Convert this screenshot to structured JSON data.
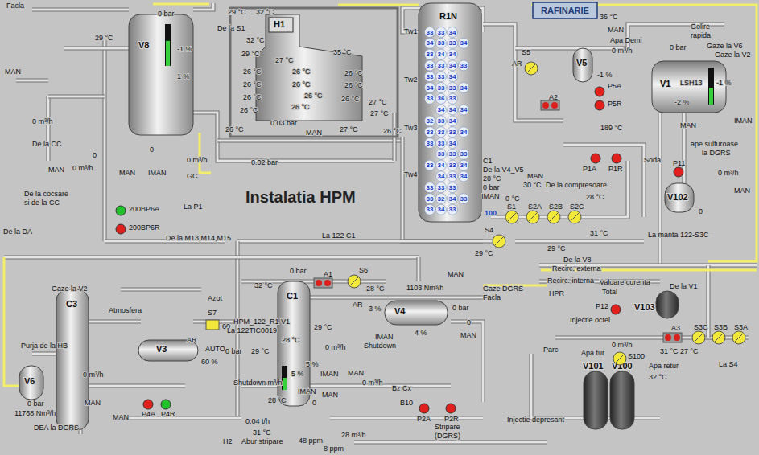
{
  "title": "Instalatia HPM",
  "badge": "RAFINARIE",
  "vessels": [
    {
      "name": "V8",
      "level": 0.6
    },
    {
      "name": "H1"
    },
    {
      "name": "R1N"
    },
    {
      "name": "V5"
    },
    {
      "name": "V1",
      "level": 0.45
    },
    {
      "name": "V102"
    },
    {
      "name": "C3"
    },
    {
      "name": "V3"
    },
    {
      "name": "V6"
    },
    {
      "name": "C1",
      "level": 0.5
    },
    {
      "name": "V4"
    },
    {
      "name": "V103"
    },
    {
      "name": "V101"
    },
    {
      "name": "V100"
    }
  ],
  "tower": {
    "zones": [
      "Tw1",
      "Tw2",
      "Tw3",
      "Tw4"
    ],
    "readings": [
      [
        "33",
        "33",
        "34"
      ],
      [
        "34",
        "33",
        "33",
        "34"
      ],
      [
        "33",
        "34",
        "34"
      ],
      [
        "33",
        "33",
        "34",
        "33"
      ],
      [
        "33",
        "33",
        "34"
      ],
      [
        "34",
        "33",
        "33",
        "34"
      ],
      [
        "33",
        "36",
        "33"
      ],
      [
        "34",
        "34",
        "34"
      ],
      [
        "32",
        "33",
        "34"
      ],
      [
        "33",
        "33",
        "33",
        "34"
      ],
      [
        "33",
        "33",
        "34"
      ],
      [
        "33",
        "33",
        "33"
      ],
      [
        "33",
        "34",
        "33",
        "34"
      ],
      [
        "34",
        "33",
        "34"
      ],
      [
        "33",
        "33",
        "33"
      ],
      [
        "33",
        "32",
        "34",
        "33"
      ],
      [
        "33",
        "34",
        "33"
      ]
    ]
  },
  "exchangers": [
    {
      "label": "S1"
    },
    {
      "label": "S2A"
    },
    {
      "label": "S2B"
    },
    {
      "label": "S2C"
    },
    {
      "label": "S4"
    },
    {
      "label": "S5"
    },
    {
      "label": "S6"
    },
    {
      "label": "S7"
    },
    {
      "label": "S3C"
    },
    {
      "label": "S3B"
    },
    {
      "label": "S3A"
    },
    {
      "label": "S100"
    }
  ],
  "pumps": [
    {
      "label": "200BP6A",
      "running": true
    },
    {
      "label": "200BP6R",
      "running": false
    },
    {
      "label": "P4A",
      "running": false
    },
    {
      "label": "P4R",
      "running": true
    },
    {
      "label": "P5A",
      "running": false
    },
    {
      "label": "P5R",
      "running": false
    },
    {
      "label": "P1A",
      "running": false
    },
    {
      "label": "P1R",
      "running": false
    },
    {
      "label": "P11",
      "running": false
    },
    {
      "label": "P2A",
      "running": false
    },
    {
      "label": "P2R",
      "running": false
    },
    {
      "label": "P12",
      "running": false
    }
  ],
  "air_coolers": [
    {
      "label": "A1"
    },
    {
      "label": "A2"
    },
    {
      "label": "A3"
    }
  ],
  "labels": [
    "Facla",
    "0 bar",
    "29 °C",
    "-1 %",
    "1 %",
    "MAN",
    "0 m³/h",
    "De la CC",
    "MAN",
    "0 m³/h",
    "0",
    "MAN",
    "IMAN",
    "0",
    "0 m³/h",
    "GC",
    "De la cocsare",
    "si de la CC",
    "De la DA",
    "La P1",
    "De la M13,M14,M15",
    "29 °C",
    "32 °C",
    "De la S1",
    "32 °C",
    "35 °C",
    "29 °C",
    "27 °C",
    "26 °C",
    "26 °C",
    "26 °C",
    "26 °C",
    "26 °C",
    "26 °C",
    "26 °C",
    "26 °C",
    "26 °C",
    "26 °C",
    "26 °C",
    "27 °C",
    "27 °C",
    "27 °C",
    "26 °C",
    "0.03 bar",
    "MAN",
    "26 °C",
    "0.02 bar",
    "C1",
    "De la V4_V5",
    "28 °C",
    "0 bar",
    "IMAN",
    "0 °C",
    "100",
    "MAN",
    "30 °C",
    "De la compresoare",
    "28 °C",
    "29 °C",
    "29 °C",
    "31 °C",
    "De la V8",
    "La 122 C1",
    "36 °C",
    "MAN",
    "Apa Demi",
    "0 m³/h",
    "AR",
    "-1 %",
    "189 °C",
    "Golire",
    "rapida",
    "0 bar",
    "Gaze la V6",
    "Gaze la V2",
    "LSH13",
    "-1 %",
    "-2 %",
    "MAN",
    "IMAN",
    "ape sulfuroase",
    "la DGRS",
    "Soda",
    "0 m³/h",
    "MAN",
    "0",
    "La manta 122-S3C",
    "Gaze la V2",
    "Atmosfera",
    "Azot",
    "AR",
    "60",
    "AUTO",
    "60 %",
    "Purja de la HB",
    "0 bar",
    "11768 Nm³/h",
    "DEA la DGRS",
    "0 m³/h",
    "MAN",
    "MAN",
    "HPM_122_R1 V1",
    "La 122TIC0019",
    "0 bar",
    "29 °C",
    "28 °C",
    "32 °C",
    "0 bar",
    "29 °C",
    "28 °C",
    "AR",
    "3 %",
    "Shutdown",
    "IMAN",
    "0 m³/h",
    "5 %",
    "5 %",
    "IMAN",
    "MAN",
    "Shutdown m³/h",
    "28 °C",
    "IMAN",
    "MAN",
    "0",
    "0.04 t/h",
    "31 °C",
    "H2",
    "Abur stripare",
    "48 ppm",
    "8 ppm",
    "28 m³/h",
    "4 %",
    "0 m³/h",
    "Bz Cx",
    "B10",
    "Stripare",
    "(DGRS)",
    "1103 Nm³/h",
    "MAN",
    "0 bar",
    "0",
    "Gaze DGRS",
    "Facla",
    "MAN",
    "Recirc. externa",
    "Recirc. interna",
    "Valoare curenta",
    "Total",
    "HPR",
    "Injectie octel",
    "De la V1",
    "Parc",
    "31 °C",
    "27 °C",
    "0 m³/h",
    "Apa tur",
    "Apa retur",
    "32 °C",
    "La S4",
    "Injectie depresant"
  ]
}
